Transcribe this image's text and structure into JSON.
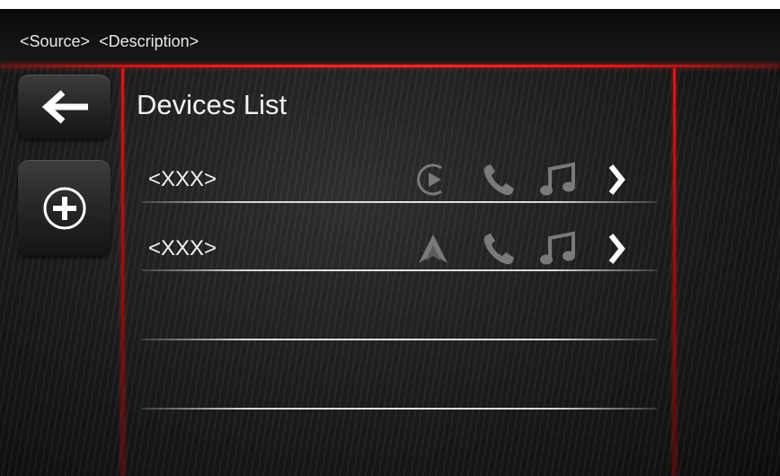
{
  "header": {
    "source": "<Source>",
    "description": "<Description>"
  },
  "sidebar": {
    "back": {
      "icon": "arrow-left-icon"
    },
    "add": {
      "icon": "plus-circle-icon"
    }
  },
  "page": {
    "title": "Devices List"
  },
  "devices": [
    {
      "name": "<XXX>",
      "icons": [
        "play-circle-icon",
        "phone-icon",
        "music-note-icon",
        "chevron-right-icon"
      ]
    },
    {
      "name": "<XXX>",
      "icons": [
        "android-auto-icon",
        "phone-icon",
        "music-note-icon",
        "chevron-right-icon"
      ]
    }
  ],
  "empty_rows": 2,
  "colors": {
    "accent": "#e01818",
    "background": "#111111",
    "text": "#f2f2f2",
    "icon_dim": "#7a7a7a"
  }
}
